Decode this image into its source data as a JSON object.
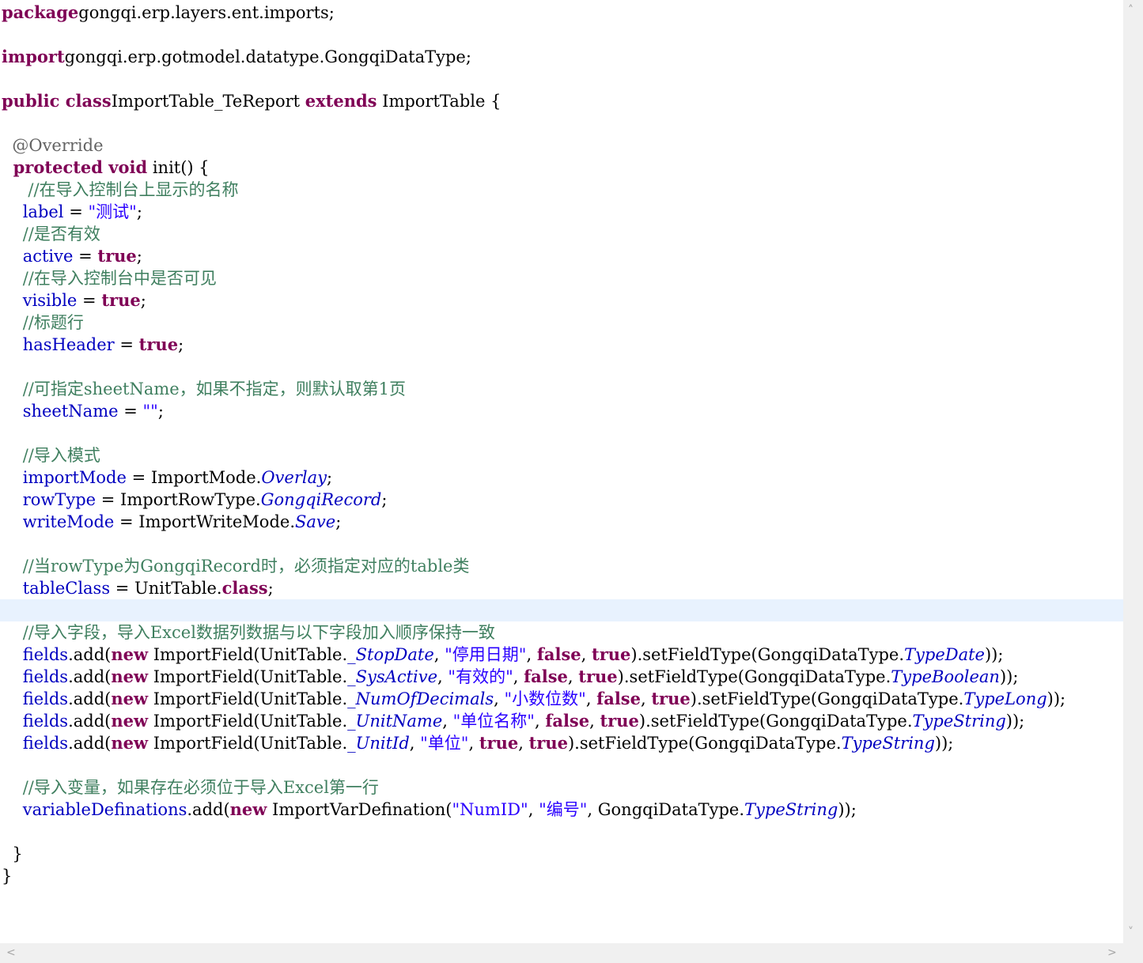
{
  "editor": {
    "highlighted_line": 27,
    "lines": [
      [
        [
          "kw",
          "package"
        ],
        [
          "",
          "gongqi.erp.layers.ent.imports;"
        ]
      ],
      [],
      [
        [
          "kw",
          "import"
        ],
        [
          "",
          "gongqi.erp.gotmodel.datatype.GongqiDataType;"
        ]
      ],
      [],
      [
        [
          "kw",
          "public class"
        ],
        [
          "",
          "ImportTable_TeReport "
        ],
        [
          "kw",
          "extends"
        ],
        [
          "",
          " ImportTable {"
        ]
      ],
      [],
      [
        [
          "ann",
          "  @Override"
        ]
      ],
      [
        [
          "kw",
          "  protected void"
        ],
        [
          "",
          " init() {"
        ]
      ],
      [
        [
          "cm",
          "     //在导入控制台上显示的名称"
        ]
      ],
      [
        [
          "",
          "    "
        ],
        [
          "fld",
          "label"
        ],
        [
          "",
          " = "
        ],
        [
          "str",
          "\"测试\""
        ],
        [
          "",
          ";"
        ]
      ],
      [
        [
          "cm",
          "    //是否有效"
        ]
      ],
      [
        [
          "",
          "    "
        ],
        [
          "fld",
          "active"
        ],
        [
          "",
          " = "
        ],
        [
          "kw",
          "true"
        ],
        [
          "",
          ";"
        ]
      ],
      [
        [
          "cm",
          "    //在导入控制台中是否可见"
        ]
      ],
      [
        [
          "",
          "    "
        ],
        [
          "fld",
          "visible"
        ],
        [
          "",
          " = "
        ],
        [
          "kw",
          "true"
        ],
        [
          "",
          ";"
        ]
      ],
      [
        [
          "cm",
          "    //标题行"
        ]
      ],
      [
        [
          "",
          "    "
        ],
        [
          "fld",
          "hasHeader"
        ],
        [
          "",
          " = "
        ],
        [
          "kw",
          "true"
        ],
        [
          "",
          ";"
        ]
      ],
      [],
      [
        [
          "cm",
          "    //可指定sheetName，如果不指定，则默认取第1页"
        ]
      ],
      [
        [
          "",
          "    "
        ],
        [
          "fld",
          "sheetName"
        ],
        [
          "",
          " = "
        ],
        [
          "str",
          "\"\""
        ],
        [
          "",
          ";"
        ]
      ],
      [],
      [
        [
          "cm",
          "    //导入模式"
        ]
      ],
      [
        [
          "",
          "    "
        ],
        [
          "fld",
          "importMode"
        ],
        [
          "",
          " = ImportMode."
        ],
        [
          "it",
          "Overlay"
        ],
        [
          "",
          ";"
        ]
      ],
      [
        [
          "",
          "    "
        ],
        [
          "fld",
          "rowType"
        ],
        [
          "",
          " = ImportRowType."
        ],
        [
          "it",
          "GongqiRecord"
        ],
        [
          "",
          ";"
        ]
      ],
      [
        [
          "",
          "    "
        ],
        [
          "fld",
          "writeMode"
        ],
        [
          "",
          " = ImportWriteMode."
        ],
        [
          "it",
          "Save"
        ],
        [
          "",
          ";"
        ]
      ],
      [],
      [
        [
          "cm",
          "    //当rowType为GongqiRecord时，必须指定对应的table类"
        ]
      ],
      [
        [
          "",
          "    "
        ],
        [
          "fld",
          "tableClass"
        ],
        [
          "",
          " = UnitTable."
        ],
        [
          "kw",
          "class"
        ],
        [
          "",
          ";"
        ]
      ],
      [],
      [
        [
          "cm",
          "    //导入字段，导入Excel数据列数据与以下字段加入顺序保持一致"
        ]
      ],
      [
        [
          "",
          "    "
        ],
        [
          "fld",
          "fields"
        ],
        [
          "",
          ".add("
        ],
        [
          "kw",
          "new"
        ],
        [
          "",
          " ImportField(UnitTable."
        ],
        [
          "it",
          "_StopDate"
        ],
        [
          "",
          ", "
        ],
        [
          "str",
          "\"停用日期\""
        ],
        [
          "",
          ", "
        ],
        [
          "kw",
          "false"
        ],
        [
          "",
          ", "
        ],
        [
          "kw",
          "true"
        ],
        [
          "",
          ").setFieldType(GongqiDataType."
        ],
        [
          "it",
          "TypeDate"
        ],
        [
          "",
          "));"
        ]
      ],
      [
        [
          "",
          "    "
        ],
        [
          "fld",
          "fields"
        ],
        [
          "",
          ".add("
        ],
        [
          "kw",
          "new"
        ],
        [
          "",
          " ImportField(UnitTable."
        ],
        [
          "it",
          "_SysActive"
        ],
        [
          "",
          ", "
        ],
        [
          "str",
          "\"有效的\""
        ],
        [
          "",
          ", "
        ],
        [
          "kw",
          "false"
        ],
        [
          "",
          ", "
        ],
        [
          "kw",
          "true"
        ],
        [
          "",
          ").setFieldType(GongqiDataType."
        ],
        [
          "it",
          "TypeBoolean"
        ],
        [
          "",
          "));"
        ]
      ],
      [
        [
          "",
          "    "
        ],
        [
          "fld",
          "fields"
        ],
        [
          "",
          ".add("
        ],
        [
          "kw",
          "new"
        ],
        [
          "",
          " ImportField(UnitTable."
        ],
        [
          "it",
          "_NumOfDecimals"
        ],
        [
          "",
          ", "
        ],
        [
          "str",
          "\"小数位数\""
        ],
        [
          "",
          ", "
        ],
        [
          "kw",
          "false"
        ],
        [
          "",
          ", "
        ],
        [
          "kw",
          "true"
        ],
        [
          "",
          ").setFieldType(GongqiDataType."
        ],
        [
          "it",
          "TypeLong"
        ],
        [
          "",
          "));"
        ]
      ],
      [
        [
          "",
          "    "
        ],
        [
          "fld",
          "fields"
        ],
        [
          "",
          ".add("
        ],
        [
          "kw",
          "new"
        ],
        [
          "",
          " ImportField(UnitTable."
        ],
        [
          "it",
          "_UnitName"
        ],
        [
          "",
          ", "
        ],
        [
          "str",
          "\"单位名称\""
        ],
        [
          "",
          ", "
        ],
        [
          "kw",
          "false"
        ],
        [
          "",
          ", "
        ],
        [
          "kw",
          "true"
        ],
        [
          "",
          ").setFieldType(GongqiDataType."
        ],
        [
          "it",
          "TypeString"
        ],
        [
          "",
          "));"
        ]
      ],
      [
        [
          "",
          "    "
        ],
        [
          "fld",
          "fields"
        ],
        [
          "",
          ".add("
        ],
        [
          "kw",
          "new"
        ],
        [
          "",
          " ImportField(UnitTable."
        ],
        [
          "it",
          "_UnitId"
        ],
        [
          "",
          ", "
        ],
        [
          "str",
          "\"单位\""
        ],
        [
          "",
          ", "
        ],
        [
          "kw",
          "true"
        ],
        [
          "",
          ", "
        ],
        [
          "kw",
          "true"
        ],
        [
          "",
          ").setFieldType(GongqiDataType."
        ],
        [
          "it",
          "TypeString"
        ],
        [
          "",
          "));"
        ]
      ],
      [],
      [
        [
          "cm",
          "    //导入变量，如果存在必须位于导入Excel第一行"
        ]
      ],
      [
        [
          "",
          "    "
        ],
        [
          "fld",
          "variableDefinations"
        ],
        [
          "",
          ".add("
        ],
        [
          "kw",
          "new"
        ],
        [
          "",
          " ImportVarDefination("
        ],
        [
          "str",
          "\"NumID\""
        ],
        [
          "",
          ", "
        ],
        [
          "str",
          "\"编号\""
        ],
        [
          "",
          ", GongqiDataType."
        ],
        [
          "it",
          "TypeString"
        ],
        [
          "",
          "));"
        ]
      ],
      [],
      [
        [
          "",
          "  }"
        ]
      ],
      [
        [
          "",
          "}"
        ]
      ]
    ]
  },
  "scrollbars": {
    "up_arrow": "˄",
    "down_arrow": "˅",
    "left_arrow": "<",
    "right_arrow": ">"
  }
}
